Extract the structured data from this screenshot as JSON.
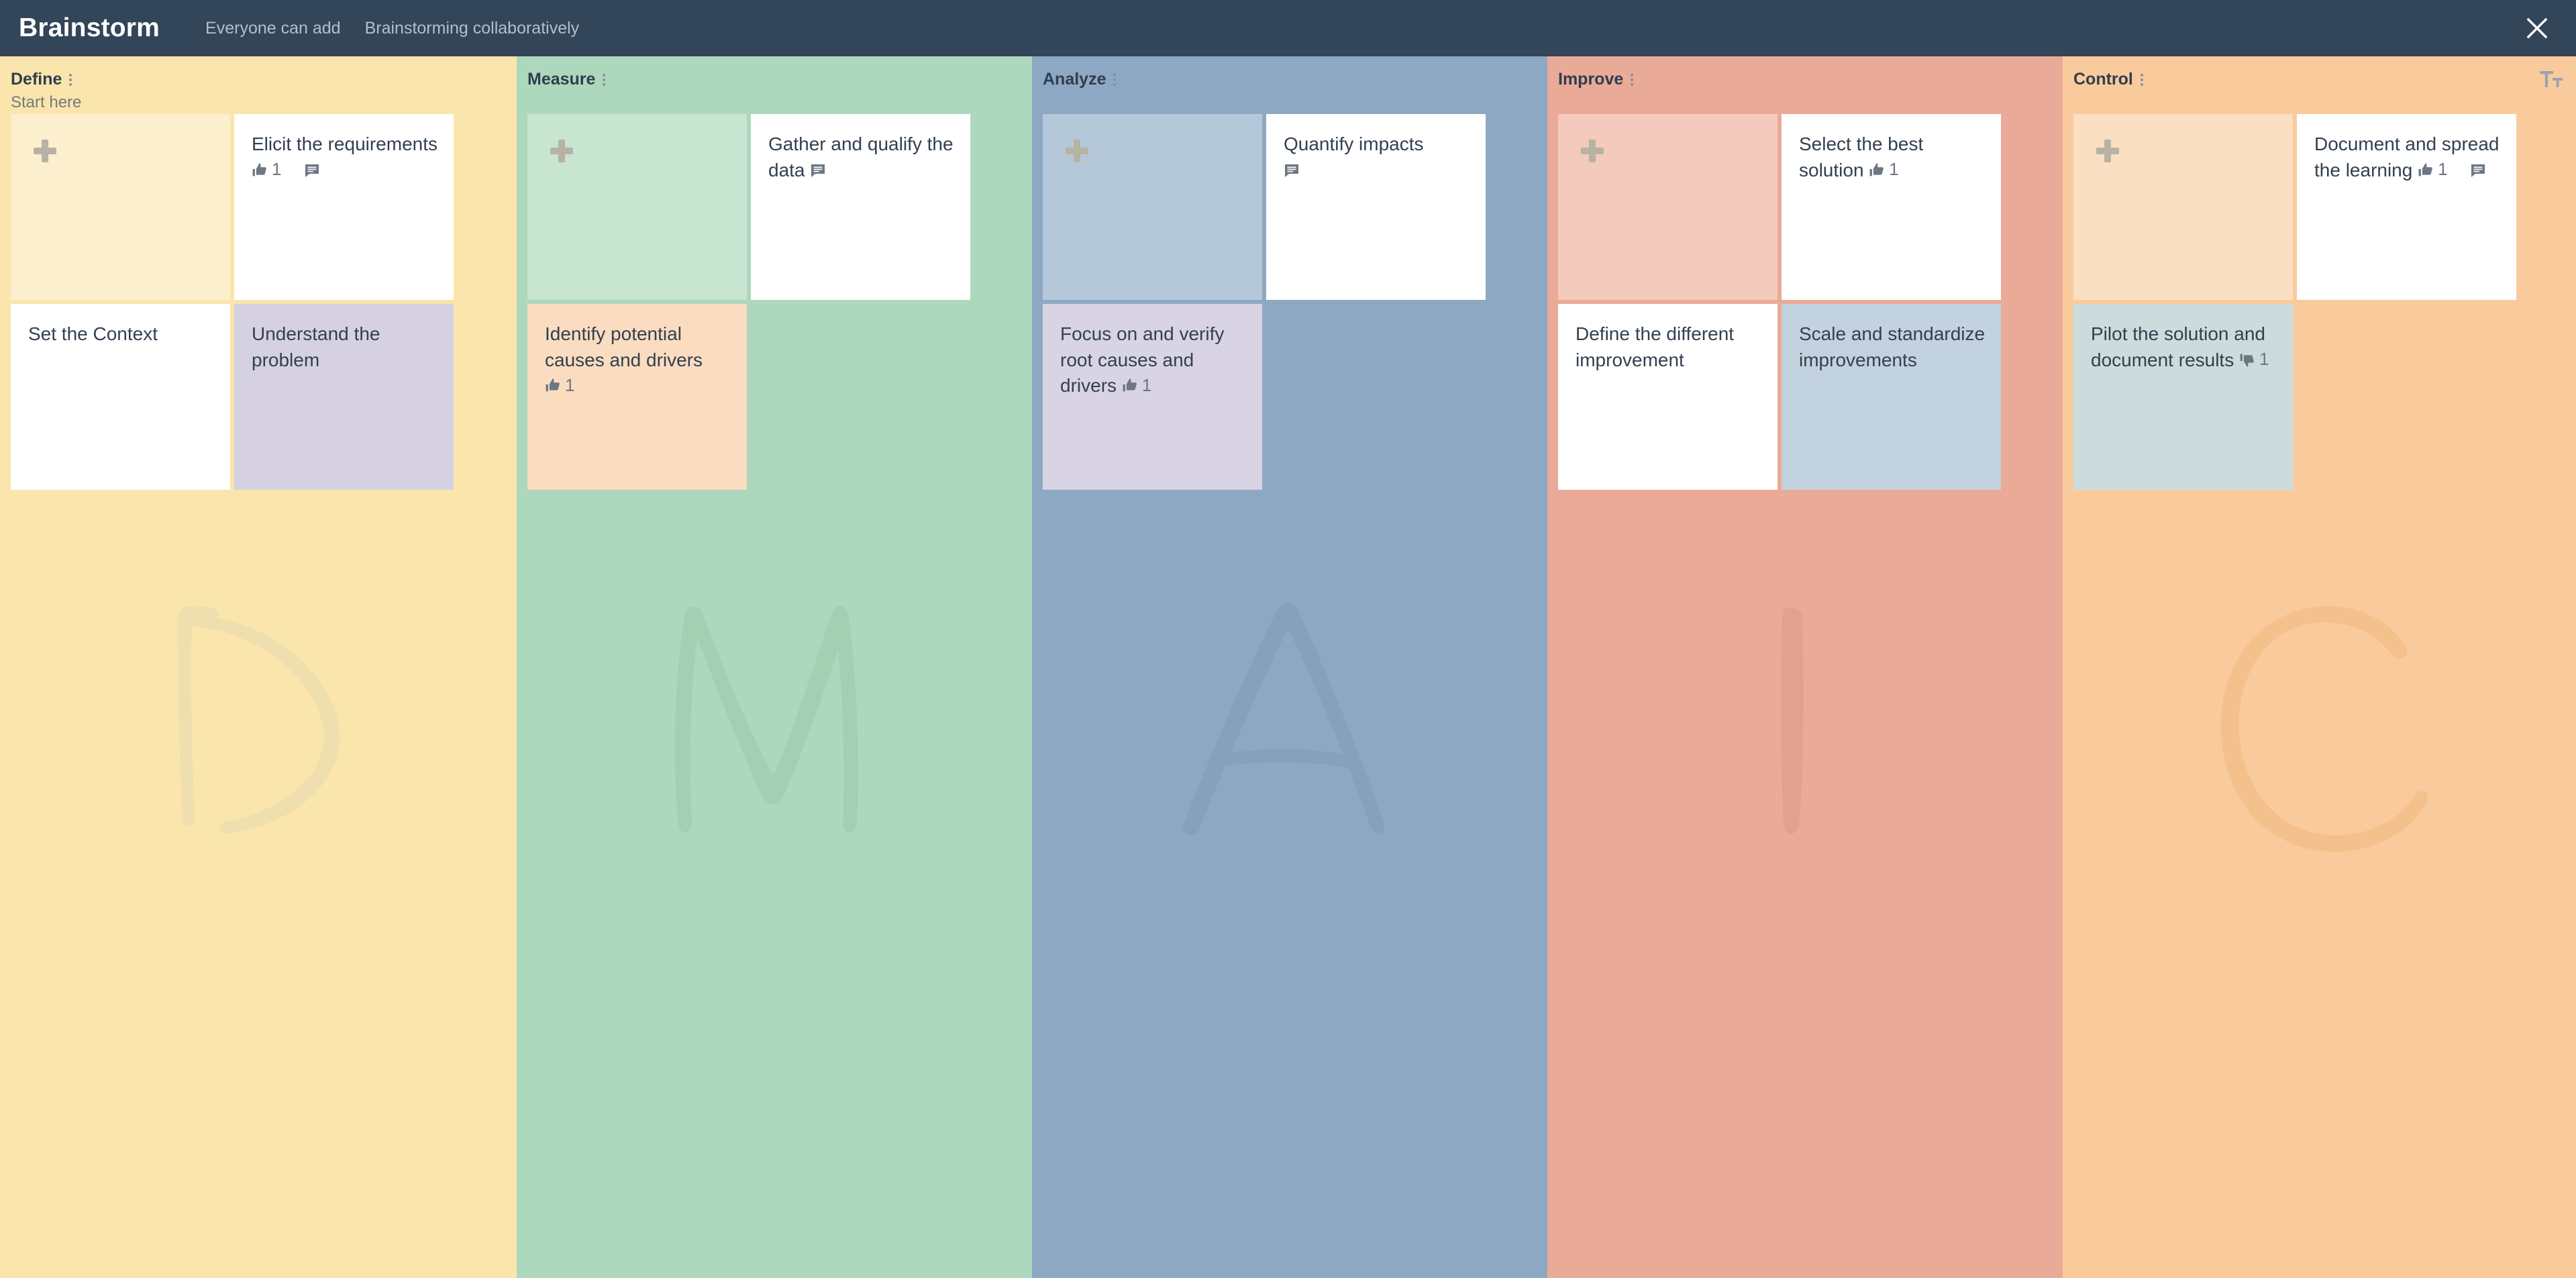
{
  "header": {
    "title": "Brainstorm",
    "meta": [
      "Everyone can add",
      "Brainstorming collaboratively"
    ],
    "close_icon": "close-icon"
  },
  "board": {
    "text_size_icon": "text-size-icon",
    "add_card_icon": "plus-icon",
    "menu_icon": "kebab-menu-icon",
    "columns": [
      {
        "id": "define",
        "title": "Define",
        "subtitle": "Start here",
        "bg": "#fae5ac",
        "add_tile_bg": "#fcefcd",
        "watermark_letter": "D",
        "watermark_color": "#f0dfae",
        "cards": [
          {
            "type": "add",
            "label": ""
          },
          {
            "type": "note",
            "text": "Elicit the requirements",
            "bg": "#ffffff",
            "likes": "1",
            "like_icon": "thumbs-up-icon",
            "comment_icon": "comment-icon",
            "has_comment": true
          },
          {
            "type": "note",
            "text": "Set the Context",
            "bg": "#ffffff",
            "likes": "",
            "has_comment": false
          },
          {
            "type": "note",
            "text": "Understand the problem",
            "bg": "#d5d1e3",
            "likes": "",
            "has_comment": false
          }
        ]
      },
      {
        "id": "measure",
        "title": "Measure",
        "subtitle": "",
        "bg": "#aed8bd",
        "add_tile_bg": "#c8e5d2",
        "watermark_letter": "M",
        "watermark_color": "#a3cfb2",
        "cards": [
          {
            "type": "add",
            "label": ""
          },
          {
            "type": "note",
            "text": "Gather and qualify the data",
            "bg": "#ffffff",
            "likes": "",
            "comment_icon": "comment-icon",
            "has_comment": true
          },
          {
            "type": "note",
            "text": "Identify potential causes and drivers",
            "bg": "#fadcc0",
            "likes": "1",
            "like_icon": "thumbs-up-icon",
            "has_comment": false
          }
        ]
      },
      {
        "id": "analyze",
        "title": "Analyze",
        "subtitle": "",
        "bg": "#8da8c3",
        "add_tile_bg": "#b4c8da",
        "watermark_letter": "A",
        "watermark_color": "#87a1bb",
        "cards": [
          {
            "type": "add",
            "label": ""
          },
          {
            "type": "note",
            "text": "Quantify impacts",
            "bg": "#ffffff",
            "likes": "",
            "comment_icon": "comment-icon",
            "has_comment": true,
            "comment_on_new_line": true
          },
          {
            "type": "note",
            "text": "Focus on and verify root causes and drivers",
            "bg": "#d8d4e4",
            "likes": "1",
            "like_icon": "thumbs-up-icon",
            "has_comment": false
          }
        ]
      },
      {
        "id": "improve",
        "title": "Improve",
        "subtitle": "",
        "bg": "#eaaa98",
        "add_tile_bg": "#f3cabb",
        "watermark_letter": "I",
        "watermark_color": "#e4a08e",
        "cards": [
          {
            "type": "add",
            "label": ""
          },
          {
            "type": "note",
            "text": "Select the best solution",
            "bg": "#ffffff",
            "likes": "1",
            "like_icon": "thumbs-up-icon",
            "has_comment": false
          },
          {
            "type": "note",
            "text": "Define the different improvement",
            "bg": "#ffffff",
            "likes": "",
            "has_comment": false
          },
          {
            "type": "note",
            "text": "Scale and standardize improvements",
            "bg": "#c2d2de",
            "likes": "",
            "has_comment": false
          }
        ]
      },
      {
        "id": "control",
        "title": "Control",
        "subtitle": "",
        "bg": "#f9cb9c",
        "add_tile_bg": "#fadfc2",
        "watermark_letter": "C",
        "watermark_color": "#f4c08c",
        "cards": [
          {
            "type": "add",
            "label": ""
          },
          {
            "type": "note",
            "text": "Document and spread the learning",
            "bg": "#ffffff",
            "likes": "1",
            "like_icon": "thumbs-up-icon",
            "comment_icon": "comment-icon",
            "has_comment": true
          },
          {
            "type": "note",
            "text": "Pilot the solution and document results",
            "bg": "#ccdcdc",
            "dislikes": "1",
            "dislike_icon": "thumbs-down-icon",
            "has_comment": false
          }
        ]
      }
    ]
  }
}
